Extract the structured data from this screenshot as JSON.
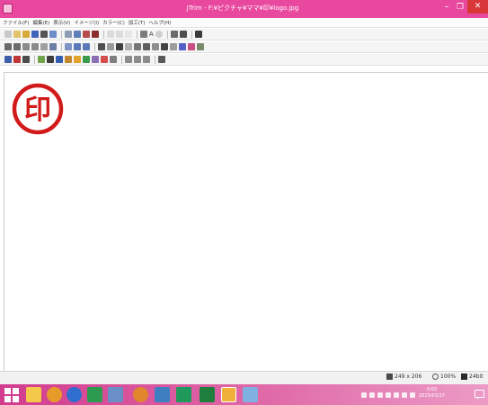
{
  "window": {
    "title": "JTrim - F:¥ピクチャ¥ママ¥印¥logo.jpg",
    "min_glyph": "–",
    "max_glyph": "❐",
    "close_glyph": "✕"
  },
  "menu": [
    "ファイル(F)",
    "編集(E)",
    "表示(V)",
    "イメージ(I)",
    "カラー(C)",
    "加工(T)",
    "ヘルプ(H)"
  ],
  "toolbar1": {
    "text_a": "A"
  },
  "stamp": {
    "glyph": "印",
    "color": "#d11a1a"
  },
  "status": {
    "dimensions": "249 x 206",
    "zoom": "100%",
    "bit_depth": "24bit"
  },
  "clock": {
    "time": "0:02",
    "date": "2015/03/17"
  },
  "colors": {
    "titlebar": "#e9489f",
    "taskbar": "#d13c8f",
    "close": "#d9383a"
  }
}
